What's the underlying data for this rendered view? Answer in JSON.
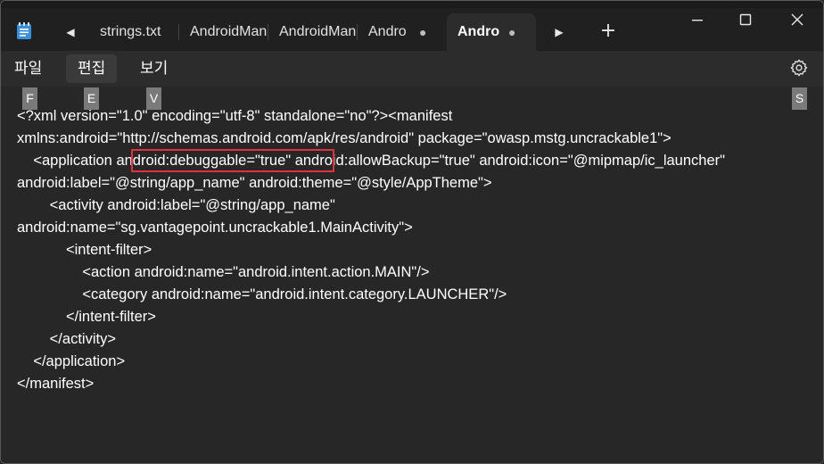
{
  "titlebar": {
    "app_icon": "notepad-icon",
    "tabs": [
      {
        "label": "strings.txt"
      },
      {
        "label": "AndroidMan"
      },
      {
        "label": "AndroidMan"
      },
      {
        "label": "Andro",
        "modified_indicator": "●"
      },
      {
        "label": "Andro",
        "modified_indicator": "●",
        "active": true
      }
    ],
    "scroll_left_icon": "chevron-left-icon",
    "scroll_right_icon": "chevron-right-icon",
    "new_tab_label": "+",
    "window_controls": [
      "minimize-icon",
      "maximize-icon",
      "close-icon"
    ]
  },
  "menubar": {
    "items": [
      {
        "label": "파일",
        "keytip": "F"
      },
      {
        "label": "편집",
        "keytip": "E"
      },
      {
        "label": "보기",
        "keytip": "V"
      }
    ],
    "settings_icon": "gear-icon",
    "settings_keytip": "S"
  },
  "editor": {
    "lines": [
      "<?xml version=\"1.0\" encoding=\"utf-8\" standalone=\"no\"?><manifest",
      "xmlns:android=\"http://schemas.android.com/apk/res/android\" package=\"owasp.mstg.uncrackable1\">",
      "    <application android:debuggable=\"true\" android:allowBackup=\"true\" android:icon=\"@mipmap/ic_launcher\"",
      "android:label=\"@string/app_name\" android:theme=\"@style/AppTheme\">",
      "        <activity android:label=\"@string/app_name\"",
      "android:name=\"sg.vantagepoint.uncrackable1.MainActivity\">",
      "            <intent-filter>",
      "                <action android:name=\"android.intent.action.MAIN\"/>",
      "                <category android:name=\"android.intent.category.LAUNCHER\"/>",
      "            </intent-filter>",
      "        </activity>",
      "    </application>",
      "</manifest>"
    ],
    "highlight_color": "#e0323a"
  }
}
